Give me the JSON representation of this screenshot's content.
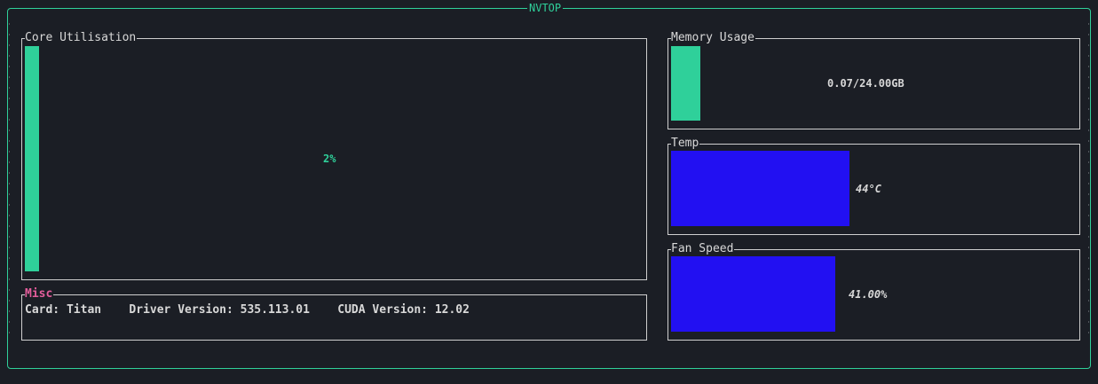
{
  "app_title": "NVTOP",
  "core": {
    "title": "Core Utilisation",
    "value_label": "2%",
    "fraction": 0.02
  },
  "misc": {
    "title": "Misc",
    "card_label": "Card:",
    "card_value": "Titan",
    "driver_label": "Driver Version:",
    "driver_value": "535.113.01",
    "cuda_label": "CUDA Version:",
    "cuda_value": "12.02"
  },
  "memory": {
    "title": "Memory Usage",
    "value_label": "0.07/24.00GB",
    "used_gb": 0.07,
    "total_gb": 24.0
  },
  "temp": {
    "title": "Temp",
    "value_label": "44°C",
    "celsius": 44
  },
  "fan": {
    "title": "Fan Speed",
    "value_label": "41.00%",
    "percent": 41.0
  },
  "colors": {
    "accent": "#2fd09a",
    "gauge_blue": "#2210f2",
    "misc_title": "#e35d9b",
    "background": "#1b1e25",
    "border": "#cfcfcf"
  }
}
